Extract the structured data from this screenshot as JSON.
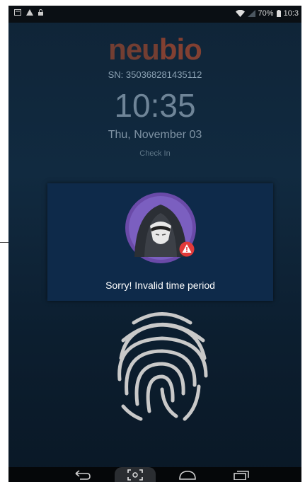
{
  "status_bar": {
    "battery_text": "70%",
    "time_text": "10:3"
  },
  "brand": {
    "logo_part1": "neu",
    "logo_part2": "bio"
  },
  "lock_screen": {
    "serial": "SN: 350368281435112",
    "time": "10:35",
    "date": "Thu, November 03",
    "mode": "Check In"
  },
  "dialog": {
    "message": "Sorry! Invalid time period"
  },
  "icons": {
    "status_left": [
      "message-icon",
      "warning-icon",
      "lock-icon"
    ],
    "status_right": [
      "wifi-icon",
      "signal-icon",
      "battery-icon"
    ],
    "nav": [
      "back-icon",
      "scan-icon",
      "home-icon",
      "recents-icon"
    ],
    "avatar": "hooded-user-icon",
    "alert": "alert-badge-icon",
    "fingerprint": "fingerprint-icon"
  },
  "colors": {
    "background_top": "#0f2437",
    "dialog_bg": "#0e2a4a",
    "avatar_ring": "#6a4aa8",
    "alert_red": "#e23a3a",
    "logo_orange": "#e0562c"
  }
}
